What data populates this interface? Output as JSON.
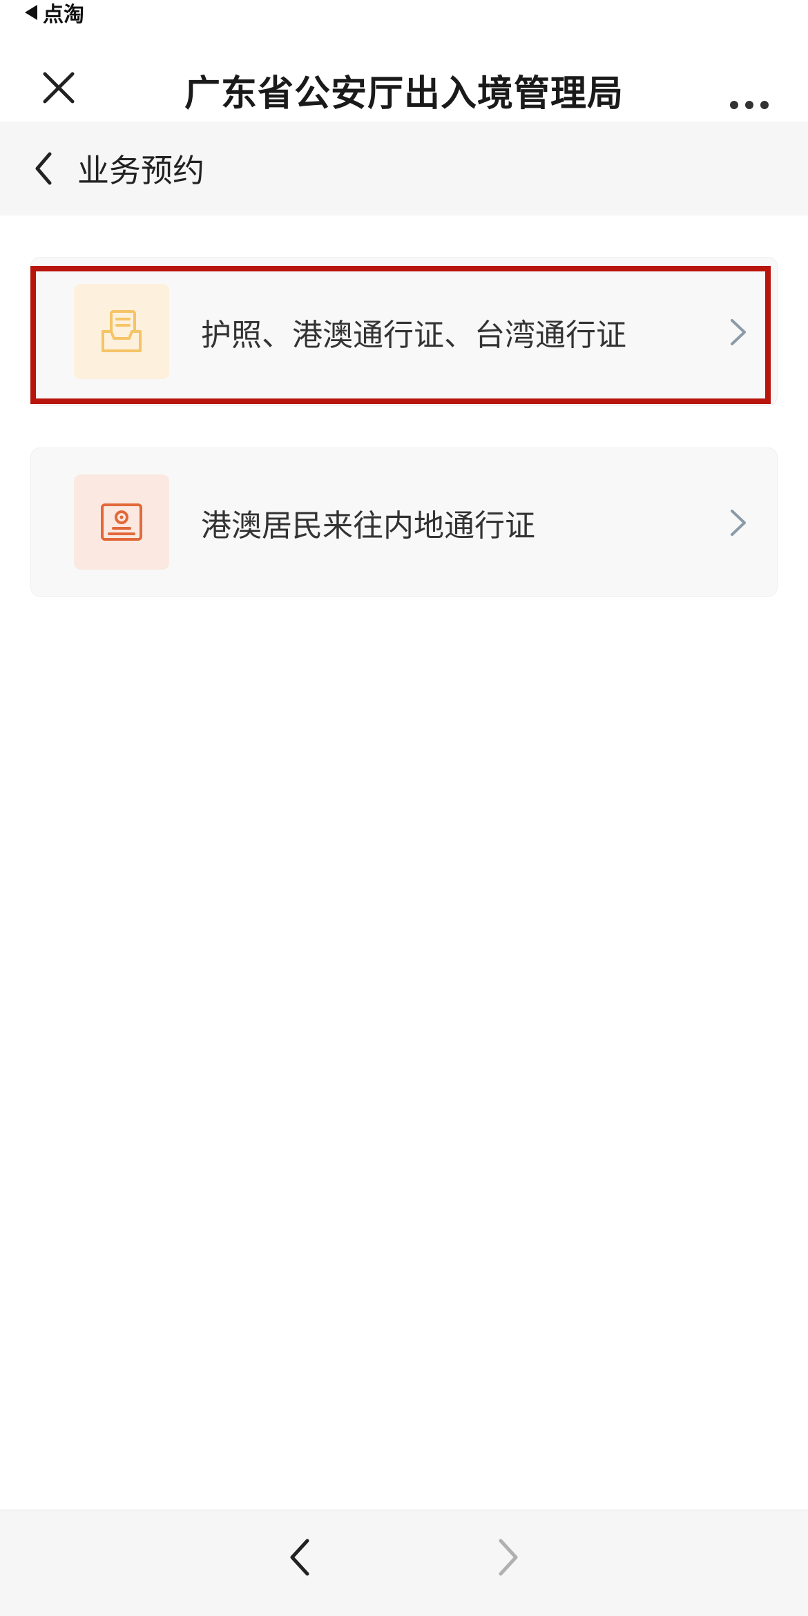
{
  "status_bar": {
    "back_app_label": "点淘"
  },
  "nav": {
    "title": "广东省公安厅出入境管理局",
    "close_icon": "close-icon",
    "more_icon": "more-icon"
  },
  "sub_header": {
    "title": "业务预约",
    "back_icon": "chevron-left-icon"
  },
  "services": [
    {
      "label": "护照、港澳通行证、台湾通行证",
      "icon": "document-tray-icon",
      "icon_color": "#f5c466",
      "icon_bg": "#fdf0dc",
      "highlighted": true
    },
    {
      "label": "港澳居民来往内地通行证",
      "icon": "id-card-icon",
      "icon_color": "#e2683a",
      "icon_bg": "#fbe9e1",
      "highlighted": false
    }
  ],
  "bottom_bar": {
    "back_icon": "chevron-left-icon",
    "forward_icon": "chevron-right-icon"
  },
  "colors": {
    "highlight": "#b8150d",
    "chevron": "#8a9aa8",
    "page_bg": "#ffffff",
    "header_bg": "#f6f6f6"
  }
}
